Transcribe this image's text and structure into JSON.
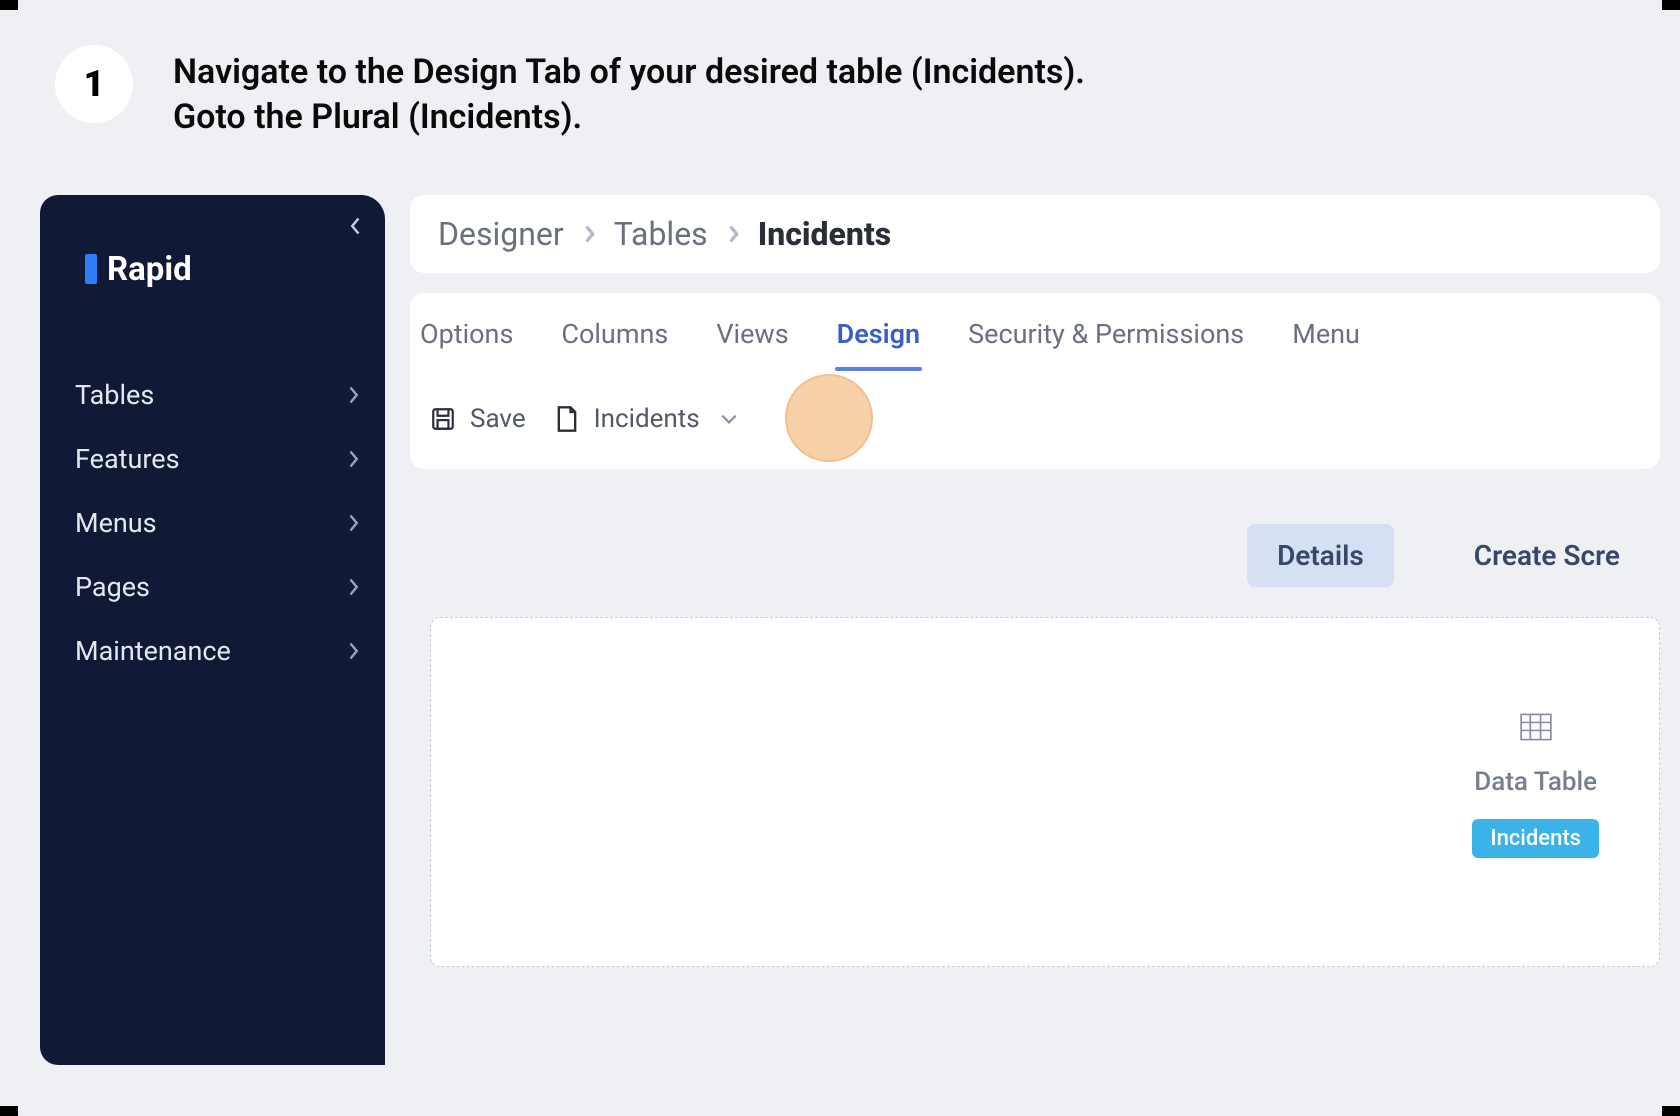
{
  "step": {
    "number": "1",
    "text_line1": "Navigate to the Design Tab of your desired table (Incidents).",
    "text_line2": "Goto the Plural (Incidents)."
  },
  "sidebar": {
    "logo": "Rapid",
    "items": [
      {
        "label": "Tables"
      },
      {
        "label": "Features"
      },
      {
        "label": "Menus"
      },
      {
        "label": "Pages"
      },
      {
        "label": "Maintenance"
      }
    ]
  },
  "breadcrumb": {
    "items": [
      "Designer",
      "Tables"
    ],
    "current": "Incidents"
  },
  "tabs": {
    "items": [
      "Options",
      "Columns",
      "Views",
      "Design",
      "Security & Permissions",
      "Menu"
    ],
    "active_index": 3
  },
  "toolbar": {
    "save_label": "Save",
    "dropdown_label": "Incidents"
  },
  "subtoolbar": {
    "details": "Details",
    "create": "Create Scre"
  },
  "canvas": {
    "widget_label": "Data Table",
    "widget_tag": "Incidents"
  }
}
